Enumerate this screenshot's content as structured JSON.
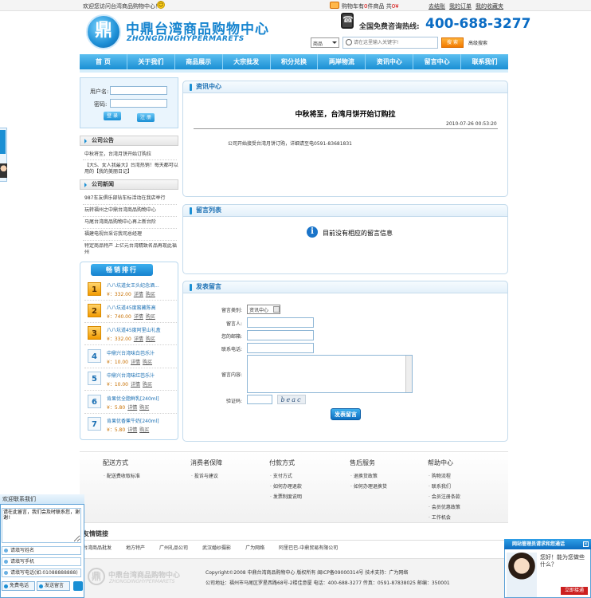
{
  "topbar": {
    "welcome": "欢迎您访问台湾商品购物中心！",
    "cart_prefix": "购物车有",
    "cart_count": "0",
    "cart_mid": "件商品",
    "cart_total_prefix": "共",
    "cart_total": "0¥",
    "links": [
      "去结账",
      "我的订单",
      "我的收藏夹"
    ]
  },
  "header": {
    "logo_glyph": "鼎",
    "logo_cn": "中鼎台湾商品购物中心",
    "logo_en": "ZHONGDINGHYPERMARETS",
    "hotline_label": "全国免费咨询热线:",
    "hotline_number": "400-688-3277",
    "search_category": "商品",
    "search_placeholder": "请在这里输入关键字!",
    "search_button": "搜 索",
    "advanced_search": "高级搜索"
  },
  "nav": [
    "首 页",
    "关于我们",
    "商品展示",
    "大宗批发",
    "积分兑换",
    "两岸物流",
    "资讯中心",
    "留言中心",
    "联系我们"
  ],
  "login": {
    "username_label": "用户名:",
    "password_label": "密码:",
    "login_button": "登 录",
    "register_button": "注 册"
  },
  "notice": {
    "title": "公司公告",
    "items": [
      "中秋将至，台湾月饼开始订购拉",
      "【大S、女人我最大】台湾热销！每天都可以用的【我的美丽日记】"
    ]
  },
  "news": {
    "title": "公司新闻",
    "items": [
      "987车友俱乐部钻车标活动在我店举行",
      "玩转福州之中鼎台湾商品购物中心",
      "马尾台湾商品购物中心再上新台阶",
      "福建电视台采访我司总经理",
      "特定商品特产 上亿元台湾精致名品再现此福州"
    ]
  },
  "ranking": {
    "title": "畅销排行",
    "buy_label": "购买",
    "detail_label": "详情",
    "items": [
      {
        "rank": "1",
        "name": "八八坑道女王头纪念酒...",
        "price": "¥：332.00"
      },
      {
        "rank": "2",
        "name": "八八坑道45度窖藏陈高",
        "price": "¥：740.00"
      },
      {
        "rank": "3",
        "name": "八八坑道45度阿里山礼盒",
        "price": "¥：332.00"
      },
      {
        "rank": "4",
        "name": "中鼎兴台湾味白芭乐汁",
        "price": "¥：10.00"
      },
      {
        "rank": "5",
        "name": "中鼎兴台湾味红芭乐汁",
        "price": "¥：10.00"
      },
      {
        "rank": "6",
        "name": "肯果优全脂鲜乳[240ml]",
        "price": "¥：5.80"
      },
      {
        "rank": "7",
        "name": "肯果优香蕉牛奶[240ml]",
        "price": "¥：5.80"
      }
    ]
  },
  "article": {
    "section": "资讯中心",
    "title": "中秋将至，台湾月饼开始订购拉",
    "time": "2010-07-26 00:53:20",
    "body": "公司开始接受台湾月饼订购，详细请至电0591-83681831"
  },
  "messages": {
    "section": "留言列表",
    "empty": "目前没有相应的留言信息"
  },
  "form": {
    "section": "发表留言",
    "type_label": "留言类别:",
    "type_value": "资讯中心",
    "name_label": "留言人:",
    "email_label": "您的邮箱:",
    "phone_label": "联系电话:",
    "content_label": "留言内容:",
    "code_label": "验证码:",
    "captcha": "beac",
    "submit": "发表留言"
  },
  "help": [
    {
      "title": "配送方式",
      "items": [
        "配送费收取标准"
      ]
    },
    {
      "title": "消费者保障",
      "items": [
        "投诉与建议"
      ]
    },
    {
      "title": "付款方式",
      "items": [
        "支付方式",
        "如何办理退款",
        "发票制度说明"
      ]
    },
    {
      "title": "售后服务",
      "items": [
        "退换货政策",
        "如何办理退换货"
      ]
    },
    {
      "title": "帮助中心",
      "items": [
        "购物流程",
        "联系我们",
        "会员注册条款",
        "会员优惠政策",
        "工作机会"
      ]
    }
  ],
  "friend_links": {
    "title": "友情链接",
    "items": [
      "台湾商品批发",
      "地方特产",
      "广州礼品公司",
      "武汉婚纱摄影",
      "广为网络",
      "阿里巴巴-中鼎贸易有限公司"
    ]
  },
  "footer": {
    "logo_glyph": "鼎",
    "logo_cn": "中鼎台湾商品购物中心",
    "logo_en": "ZHONGDINGHYPERMARETS",
    "line1": "Copyright©2008 中鼎台湾商品购物中心 版权所有 闽ICP备09000314号 技术支持：广为网络",
    "line2": "公司地址：福州市马尾区罗星西路68号-2楼佳意厦 电话：400-688-3277 传真：0591-87838025 邮编：350001"
  },
  "contact_widget": {
    "title": "欢迎联系我们",
    "message": "请在此留言，我们会及时联系您，谢谢!",
    "name_placeholder": "请填写姓名",
    "mobile_placeholder": "请填写手机",
    "phone_placeholder": "请填写电话(如:01088888888)",
    "free_call": "免费电话",
    "send": "发送留言"
  },
  "chat_widget": {
    "title": "网站管理员请求和您通话",
    "greeting": "您好！能为您做些什么？",
    "accept": "立即接通"
  }
}
